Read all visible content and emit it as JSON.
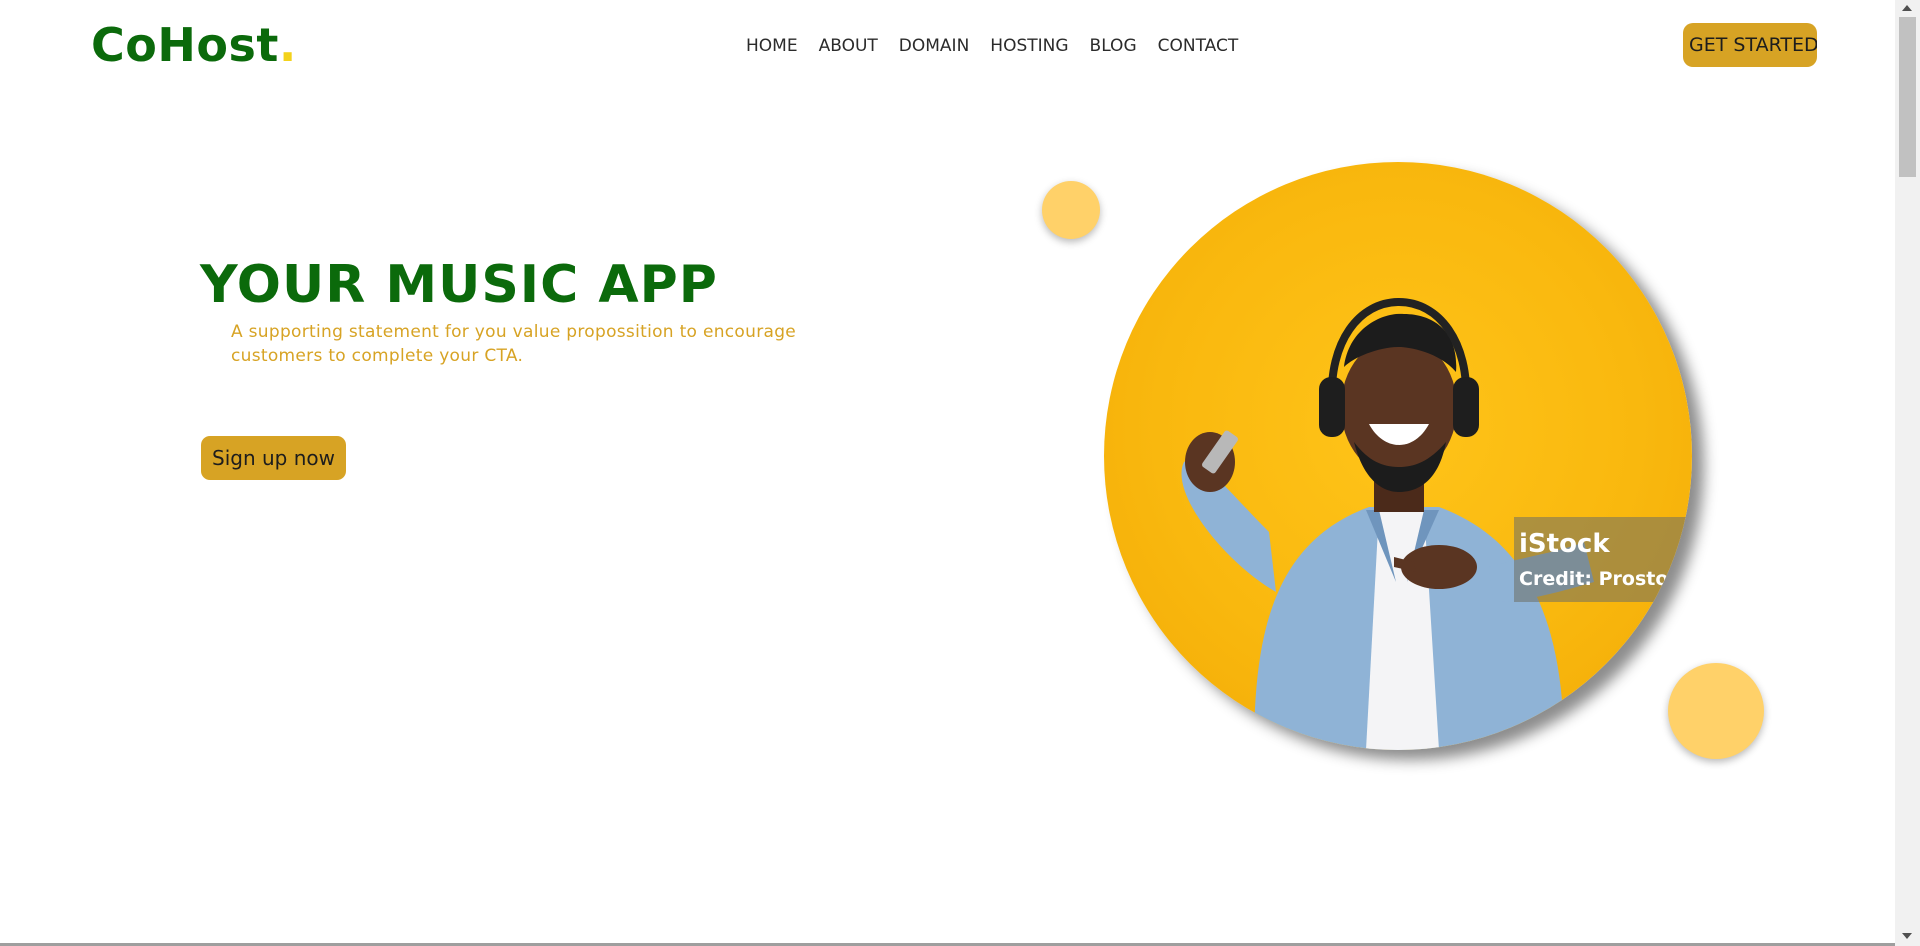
{
  "brand": {
    "name": "CoHost",
    "dot": ".",
    "primary_color": "#0b6a0b",
    "accent_color": "#d7a324",
    "dot_color": "#f3d21b"
  },
  "nav": {
    "items": [
      {
        "label": "HOME"
      },
      {
        "label": "ABOUT"
      },
      {
        "label": "DOMAIN"
      },
      {
        "label": "HOSTING"
      },
      {
        "label": "BLOG"
      },
      {
        "label": "CONTACT"
      }
    ],
    "cta_label": "GET STARTED"
  },
  "hero": {
    "title": "YOUR MUSIC APP",
    "subtitle": "A supporting statement for you value propossition to encourage customers to complete your CTA.",
    "button_label": "Sign up now",
    "image": {
      "watermark_brand": "iStock",
      "watermark_credit": "Credit: Prostock",
      "background_color": "#f9b80e"
    }
  },
  "icons": [
    "headphones-icon",
    "phone-icon",
    "scroll-up-arrow-icon",
    "scroll-down-arrow-icon"
  ]
}
